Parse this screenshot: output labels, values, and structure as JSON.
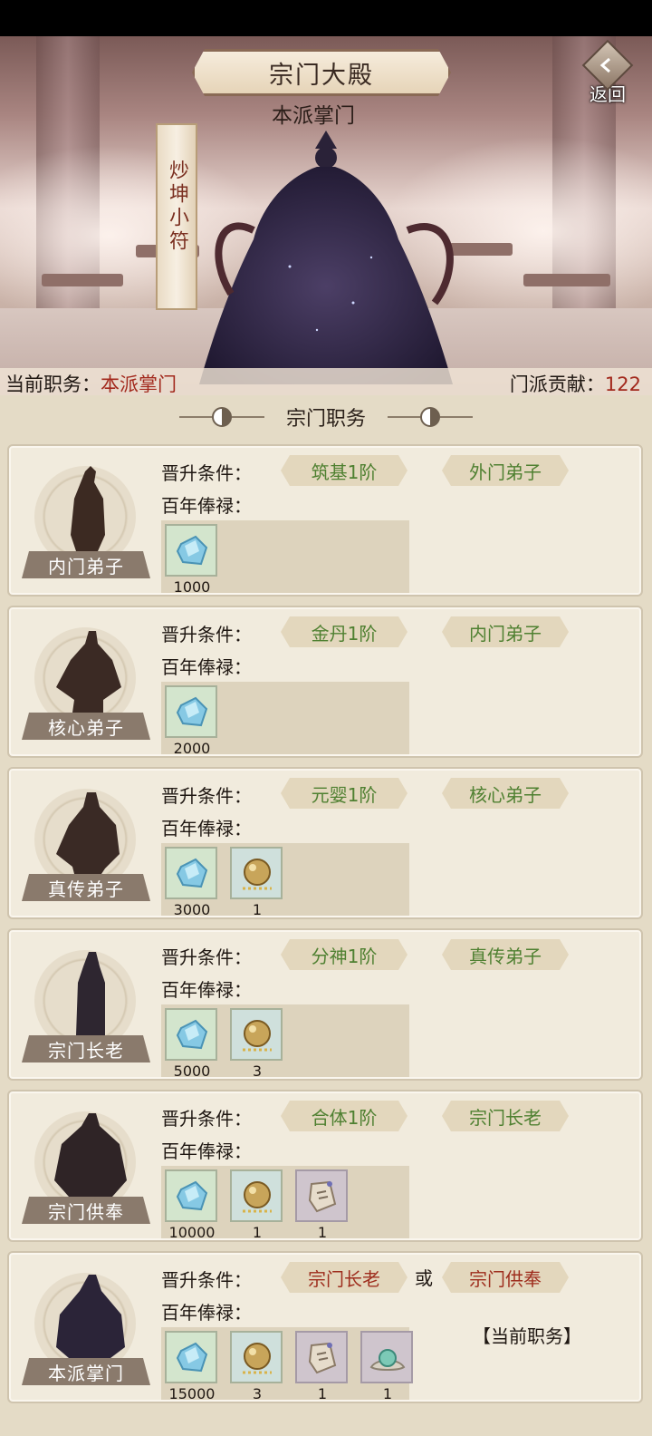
{
  "header": {
    "title": "宗门大殿",
    "leader_title": "本派掌门",
    "back_label": "返回",
    "player_name": "炒坤小符"
  },
  "status": {
    "rank_label": "当前职务：",
    "rank_value": "本派掌门",
    "contrib_label": "门派贡献：",
    "contrib_value": "122"
  },
  "section_title": "宗门职务",
  "labels": {
    "promote": "晋升条件：",
    "salary": "百年俸禄：",
    "or": "或",
    "current": "【当前职务】"
  },
  "ranks": [
    {
      "name": "内门弟子",
      "reqs": [
        "筑基1阶",
        "外门弟子"
      ],
      "req_color": "green",
      "rewards": [
        {
          "icon": "spirit-stone-icon",
          "qty": "1000"
        }
      ]
    },
    {
      "name": "核心弟子",
      "reqs": [
        "金丹1阶",
        "内门弟子"
      ],
      "req_color": "green",
      "rewards": [
        {
          "icon": "spirit-stone-icon",
          "qty": "2000"
        }
      ]
    },
    {
      "name": "真传弟子",
      "reqs": [
        "元婴1阶",
        "核心弟子"
      ],
      "req_color": "green",
      "rewards": [
        {
          "icon": "spirit-stone-icon",
          "qty": "3000"
        },
        {
          "icon": "golden-pill-icon",
          "qty": "1"
        }
      ]
    },
    {
      "name": "宗门长老",
      "reqs": [
        "分神1阶",
        "真传弟子"
      ],
      "req_color": "green",
      "rewards": [
        {
          "icon": "spirit-stone-icon",
          "qty": "5000"
        },
        {
          "icon": "golden-pill-icon",
          "qty": "3"
        }
      ]
    },
    {
      "name": "宗门供奉",
      "reqs": [
        "合体1阶",
        "宗门长老"
      ],
      "req_color": "green",
      "rewards": [
        {
          "icon": "spirit-stone-icon",
          "qty": "10000"
        },
        {
          "icon": "golden-pill-icon",
          "qty": "1"
        },
        {
          "icon": "talisman-scroll-icon",
          "qty": "1"
        }
      ]
    },
    {
      "name": "本派掌门",
      "reqs": [
        "宗门长老",
        "宗门供奉"
      ],
      "req_color": "red",
      "current": true,
      "rewards": [
        {
          "icon": "spirit-stone-icon",
          "qty": "15000"
        },
        {
          "icon": "golden-pill-icon",
          "qty": "3"
        },
        {
          "icon": "talisman-scroll-icon",
          "qty": "1"
        },
        {
          "icon": "jade-orb-icon",
          "qty": "1"
        }
      ]
    }
  ],
  "colors": {
    "accent_red": "#a2281c",
    "req_green": "#4f8031",
    "req_red": "#9e2d1d",
    "panel_bg": "#e4dbc6"
  }
}
